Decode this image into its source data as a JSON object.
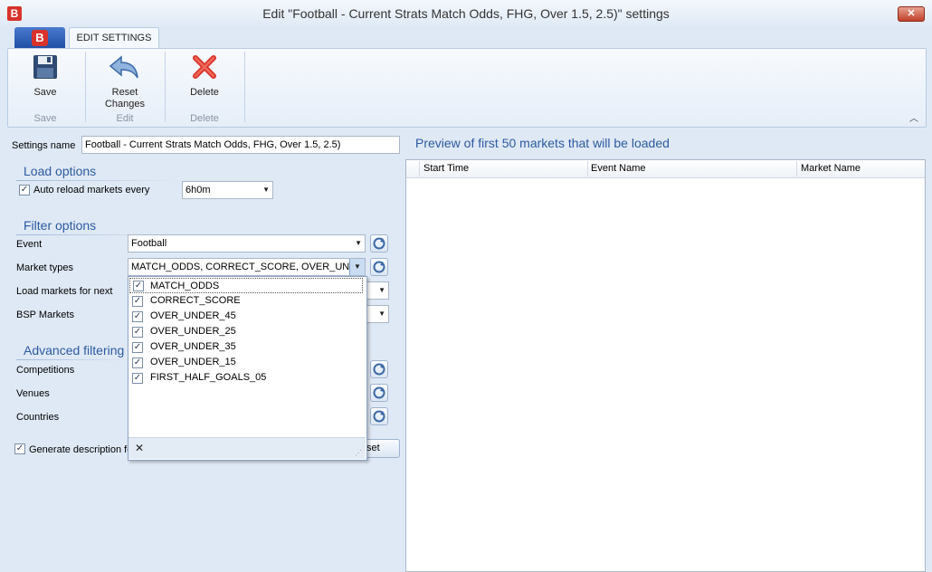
{
  "window": {
    "title": "Edit \"Football - Current Strats Match Odds, FHG, Over 1.5, 2.5)\" settings",
    "close_glyph": "✕",
    "logo_glyph": "B"
  },
  "ribbon": {
    "app_logo_glyph": "B",
    "tabs": [
      {
        "label": "EDIT SETTINGS"
      }
    ],
    "groups": [
      {
        "button_label": "Save",
        "group_label": "Save",
        "icon": "save-icon"
      },
      {
        "button_label": "Reset Changes",
        "button_label_line1": "Reset",
        "button_label_line2": "Changes",
        "group_label": "Edit",
        "icon": "undo-icon"
      },
      {
        "button_label": "Delete",
        "group_label": "Delete",
        "icon": "delete-icon"
      }
    ],
    "collapse_glyph": "︿"
  },
  "settings_name": {
    "label": "Settings name",
    "value": "Football - Current Strats Match Odds, FHG, Over 1.5, 2.5)"
  },
  "load_options": {
    "title": "Load options",
    "auto_reload_label": "Auto reload markets every",
    "auto_reload_checked": true,
    "auto_reload_value": "6h0m"
  },
  "filter_options": {
    "title": "Filter options",
    "event_label": "Event",
    "event_value": "Football",
    "market_types_label": "Market types",
    "market_types_value": "MATCH_ODDS, CORRECT_SCORE, OVER_UND...",
    "load_markets_label": "Load markets for next",
    "bsp_markets_label": "BSP Markets"
  },
  "market_types_dropdown": {
    "items": [
      {
        "label": "MATCH_ODDS",
        "checked": true
      },
      {
        "label": "CORRECT_SCORE",
        "checked": true
      },
      {
        "label": "OVER_UNDER_45",
        "checked": true
      },
      {
        "label": "OVER_UNDER_25",
        "checked": true
      },
      {
        "label": "OVER_UNDER_35",
        "checked": true
      },
      {
        "label": "OVER_UNDER_15",
        "checked": true
      },
      {
        "label": "FIRST_HALF_GOALS_05",
        "checked": true
      }
    ],
    "clear_glyph": "✕"
  },
  "advanced_filtering": {
    "title": "Advanced filtering",
    "competitions_label": "Competitions",
    "venues_label": "Venues",
    "countries_label": "Countries"
  },
  "generate_description": {
    "label": "Generate description fo",
    "checked": true,
    "button_partial_label": "set"
  },
  "preview": {
    "title": "Preview of first 50 markets that will be loaded",
    "columns": [
      "Start Time",
      "Event Name",
      "Market Name"
    ],
    "rows": []
  },
  "colors": {
    "accent": "#2c5aa0",
    "brand": "#d8332b",
    "window_bg": "#dfe9f5"
  }
}
